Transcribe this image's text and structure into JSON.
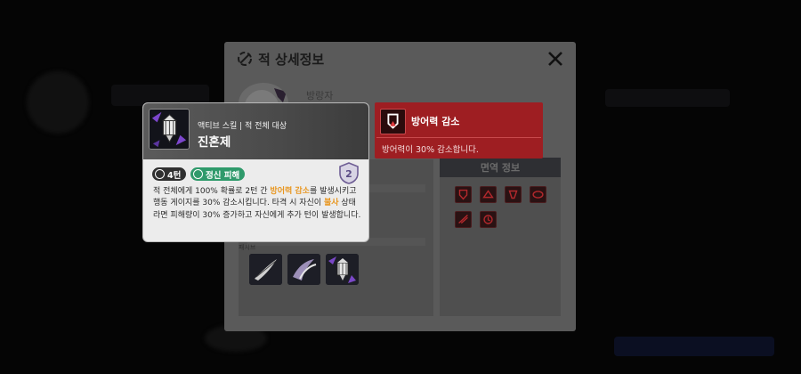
{
  "modal": {
    "title": "적 상세정보",
    "enemy_name": "방랑자",
    "resistance_header": "면역 정보",
    "sub_label": "패시브"
  },
  "debuff": {
    "title": "방어력 감소",
    "description": "방어력이 30% 감소합니다."
  },
  "tooltip": {
    "skill_type": "액티브 스킬 | 적 전체 대상",
    "skill_name": "진혼제",
    "turn_label": "4턴",
    "damage_type": "정신 피해",
    "level": "2",
    "desc": {
      "p1": "적 전체에게 100% 확률로 2턴 간 ",
      "h1": "방어력 감소",
      "p2": "를 발생시키고 행동 게이지를 30% 감소시킵니다. 타격 시 자신이 ",
      "h2": "불사",
      "p3": " 상태라면 피해량이 30% 증가하고 자신에게 추가 턴이 발생합니다."
    }
  },
  "colors": {
    "debuff_red": "#9e1e22",
    "highlight": "#e8961f",
    "mental_damage_green": "#2f9a6b"
  }
}
